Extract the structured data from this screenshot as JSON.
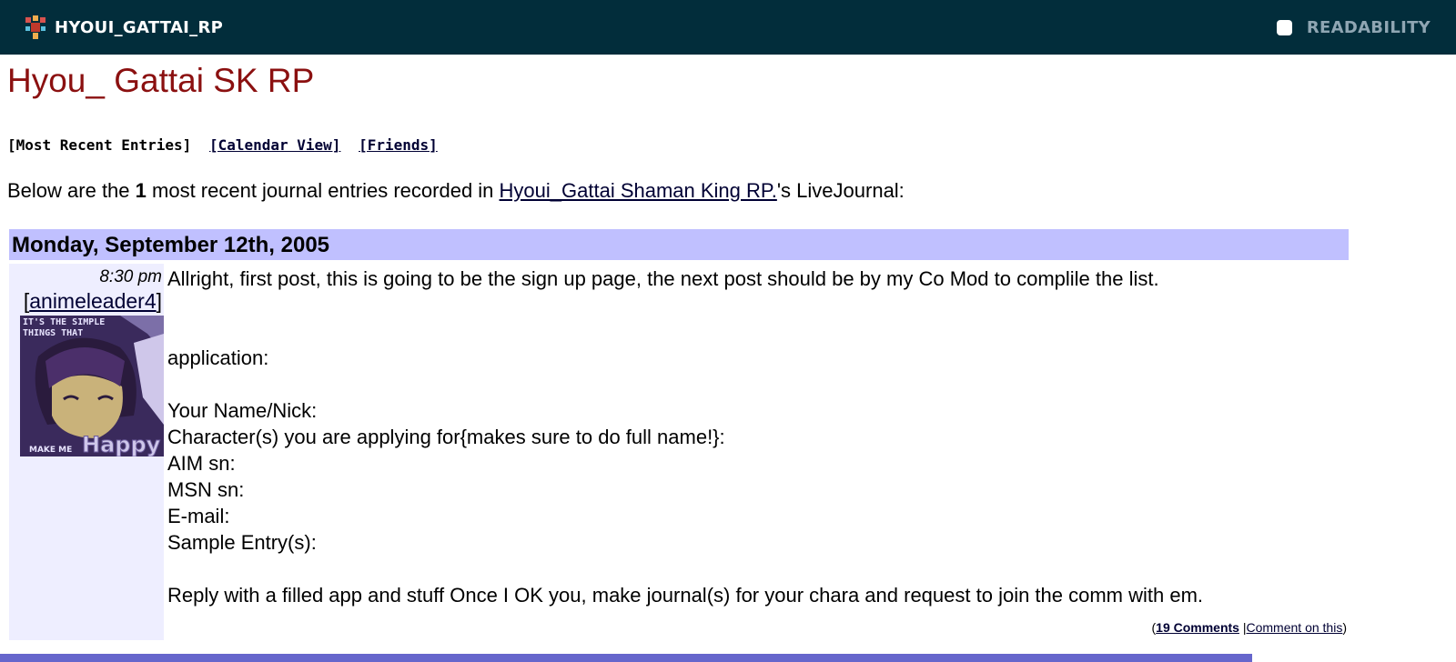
{
  "topbar": {
    "brand_name": "HYOUI_GATTAI_RP",
    "readability_label": "READABILITY"
  },
  "page": {
    "title": "Hyou_ Gattai SK RP"
  },
  "nav": {
    "most_recent": "[Most Recent Entries]",
    "calendar": "[Calendar View]",
    "friends": "[Friends]"
  },
  "intro": {
    "prefix": "Below are the ",
    "count": "1",
    "middle": " most recent journal entries recorded in ",
    "journal_name": "Hyoui_Gattai Shaman King RP.",
    "suffix": "'s LiveJournal:"
  },
  "entry": {
    "date": "Monday, September 12th, 2005",
    "time": "8:30 pm",
    "user_open": "[",
    "username": "animeleader4",
    "user_close": "]",
    "userpic": {
      "top_text_1": "IT'S THE SIMPLE",
      "top_text_2": "THINGS THAT",
      "bottom_small": "MAKE ME",
      "bottom_big": "Happy"
    },
    "lines": {
      "intro": "Allright, first post, this is going to be the sign up page, the next post should be by my Co Mod to complile the list.",
      "application": "application:",
      "name": "Your Name/Nick:",
      "character": "Character(s) you are applying for{makes sure to do full name!}:",
      "aim": "AIM sn:",
      "msn": "MSN sn:",
      "email": "E-mail:",
      "sample": "Sample Entry(s):",
      "reply": "Reply with a filled app and stuff Once I OK you, make journal(s) for your chara and request to join the comm with em."
    },
    "comments": {
      "open": "(",
      "comments_link": "19 Comments",
      "separator": " |",
      "comment_on_this": "Comment on this",
      "close": ")"
    }
  },
  "colors": {
    "topbar_bg": "#022d3b",
    "title_color": "#8b1010",
    "date_bar_bg": "#c0c0ff",
    "side_bg": "#eeeeff",
    "bottom_bar": "#6666cc"
  }
}
